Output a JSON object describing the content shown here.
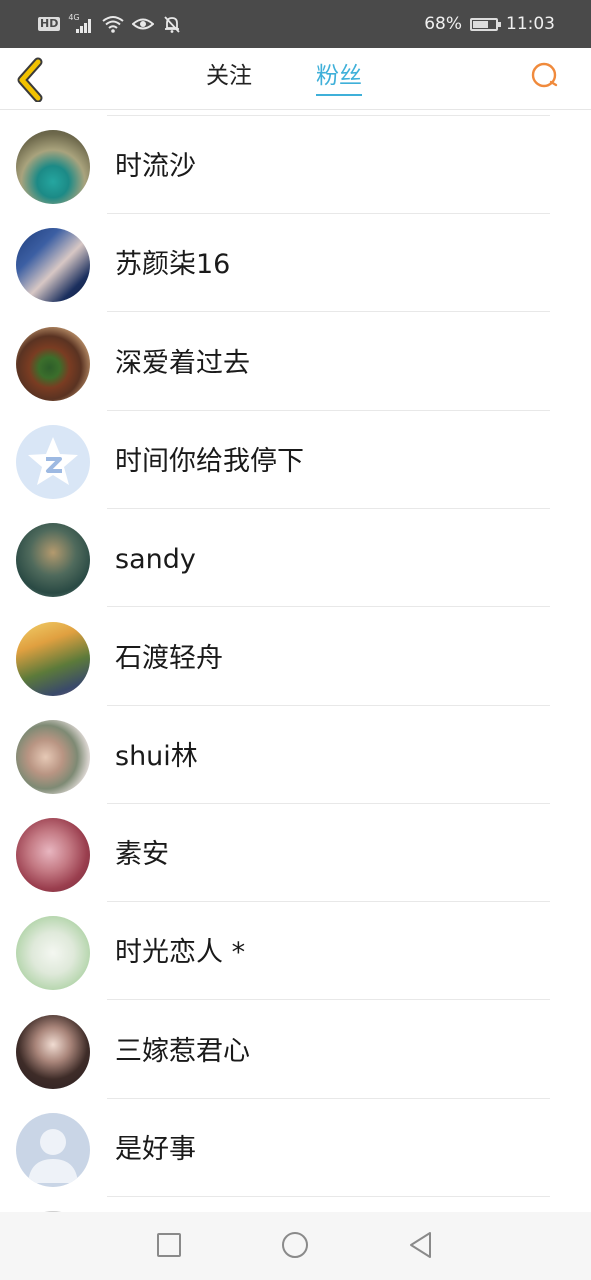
{
  "status_bar": {
    "network_badge": "HD",
    "network_type": "4G",
    "battery_percent": "68%",
    "time": "11:03",
    "battery_level": 0.68,
    "icons": [
      "wifi-icon",
      "eye-comfort-icon",
      "bell-muted-icon"
    ]
  },
  "header": {
    "back_icon": "chevron-left-icon",
    "tabs": [
      {
        "label": "关注",
        "active": false
      },
      {
        "label": "粉丝",
        "active": true
      }
    ],
    "search_icon": "search-icon",
    "accent_color": "#3fb0d9",
    "back_color": "#f2c200",
    "search_color": "#f08a3c"
  },
  "fans": [
    {
      "name": "时流沙"
    },
    {
      "name": "苏颜柒16"
    },
    {
      "name": "深爱着过去"
    },
    {
      "name": "时间你给我停下"
    },
    {
      "name": "sandy"
    },
    {
      "name": "石渡轻舟"
    },
    {
      "name": "shui林"
    },
    {
      "name": "素安"
    },
    {
      "name": "时光恋人 *"
    },
    {
      "name": "三嫁惹君心"
    },
    {
      "name": "是好事"
    }
  ],
  "nav_bar": {
    "icons": [
      "recent-apps-icon",
      "home-icon",
      "back-icon"
    ]
  }
}
